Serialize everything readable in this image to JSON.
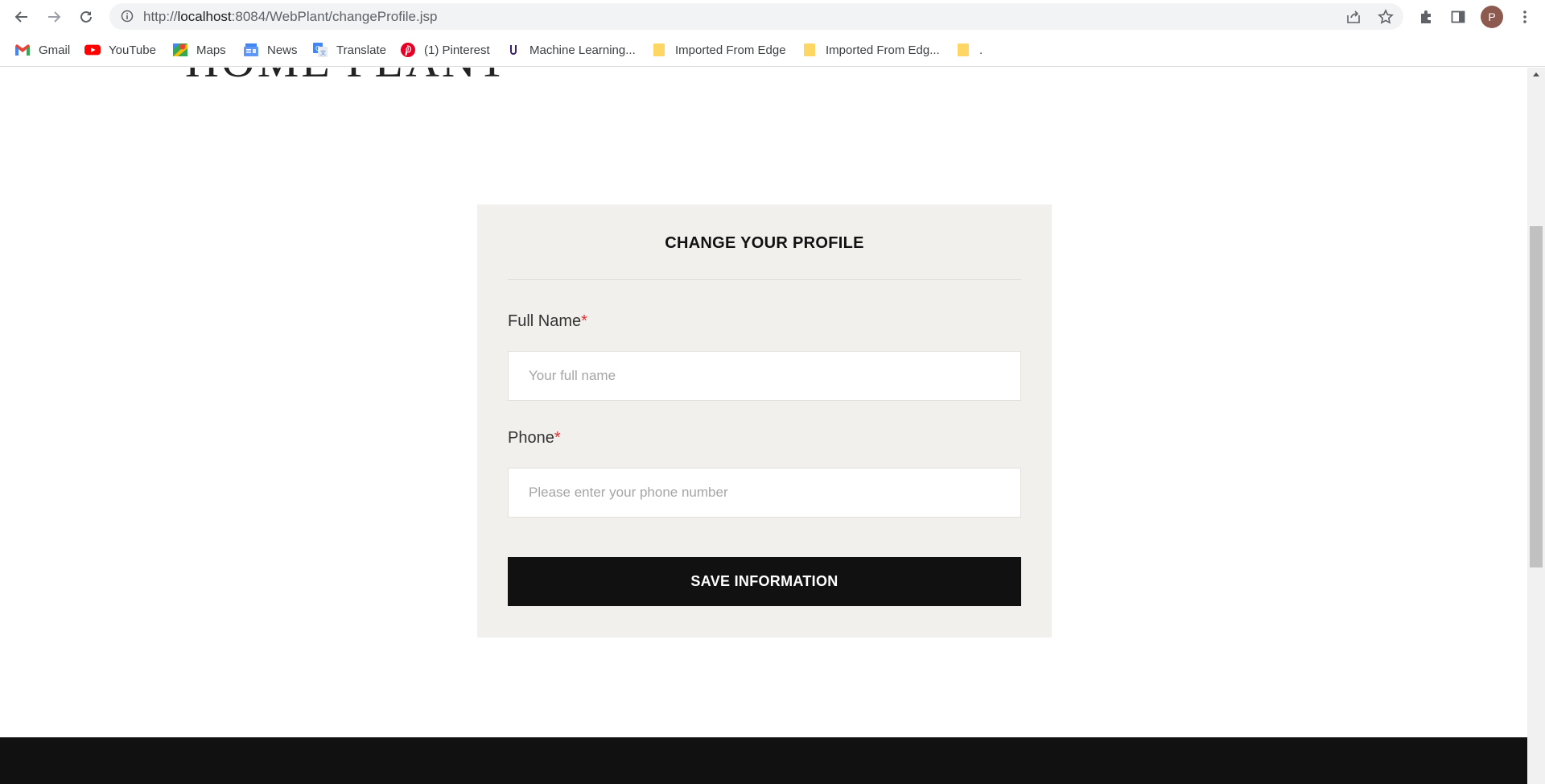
{
  "browser": {
    "url_prefix": "http://",
    "url_host": "localhost",
    "url_rest": ":8084/WebPlant/changeProfile.jsp",
    "profile_initial": "P"
  },
  "bookmarks": [
    {
      "label": "Gmail",
      "icon": "gmail-icon"
    },
    {
      "label": "YouTube",
      "icon": "youtube-icon"
    },
    {
      "label": "Maps",
      "icon": "maps-icon"
    },
    {
      "label": "News",
      "icon": "news-icon"
    },
    {
      "label": "Translate",
      "icon": "translate-icon"
    },
    {
      "label": "(1) Pinterest",
      "icon": "pinterest-icon"
    },
    {
      "label": "Machine Learning...",
      "icon": "machine-learning-icon"
    },
    {
      "label": "Imported From Edge",
      "icon": "folder-icon"
    },
    {
      "label": "Imported From Edg...",
      "icon": "folder-icon"
    },
    {
      "label": ".",
      "icon": "folder-icon"
    }
  ],
  "page": {
    "logo_text": "HOME PLANT"
  },
  "form": {
    "title": "CHANGE YOUR PROFILE",
    "full_name_label": "Full Name",
    "full_name_placeholder": "Your full name",
    "phone_label": "Phone",
    "phone_placeholder": "Please enter your phone number",
    "required_mark": "*",
    "save_label": "SAVE INFORMATION"
  },
  "colors": {
    "card_bg": "#f2f0ed",
    "button_bg": "#111111",
    "required": "#e03131"
  }
}
